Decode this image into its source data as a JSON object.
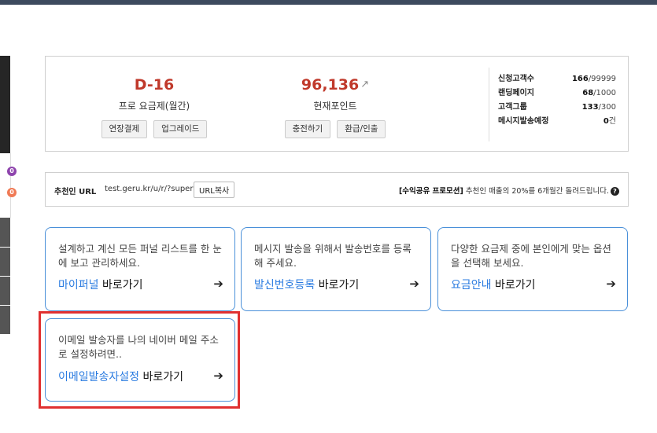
{
  "sidebar": {
    "badges": [
      "0",
      "0"
    ],
    "colors": {
      "purple": "#8e44ad",
      "orange": "#f07a55"
    }
  },
  "stats": {
    "d_day": "D-16",
    "plan_label": "프로 요금제(월간)",
    "extend_button": "연장결제",
    "upgrade_button": "업그레이드",
    "points_value": "96,136",
    "points_label": "현재포인트",
    "charge_button": "충전하기",
    "refund_button": "환급/인출",
    "metrics": [
      {
        "label": "신청고객수",
        "value": "166",
        "max": "/99999"
      },
      {
        "label": "랜딩페이지",
        "value": "68",
        "max": "/1000"
      },
      {
        "label": "고객그룹",
        "value": "133",
        "max": "/300"
      },
      {
        "label": "메시지발송예정",
        "value": "0",
        "max": "건"
      }
    ]
  },
  "referral": {
    "label": "추천인 URL",
    "url": "test.geru.kr/u/r/?super",
    "copy_button": "URL복사",
    "promo_bold": "[수익공유 프로모션]",
    "promo_text": " 추천인 매출의 20%를 6개월간 돌려드립니다.",
    "help_icon": "?"
  },
  "cards": [
    {
      "desc": "설계하고 계신 모든 퍼널 리스트를 한 눈에 보고 관리하세요.",
      "link_blue": "마이퍼널",
      "link_rest": " 바로가기"
    },
    {
      "desc": "메시지 발송을 위해서 발송번호를 등록해 주세요.",
      "link_blue": "발신번호등록",
      "link_rest": " 바로가기"
    },
    {
      "desc": "다양한 요금제 중에 본인에게 맞는 옵션을 선택해 보세요.",
      "link_blue": "요금안내",
      "link_rest": " 바로가기"
    },
    {
      "desc": "이메일 발송자를 나의 네이버 메일 주소로 설정하려면..",
      "link_blue": "이메일발송자설정",
      "link_rest": " 바로가기"
    }
  ],
  "arrow_glyph": "➔",
  "colors": {
    "accent": "#2a7be0",
    "danger": "#c0392b",
    "highlight": "#e03030"
  }
}
